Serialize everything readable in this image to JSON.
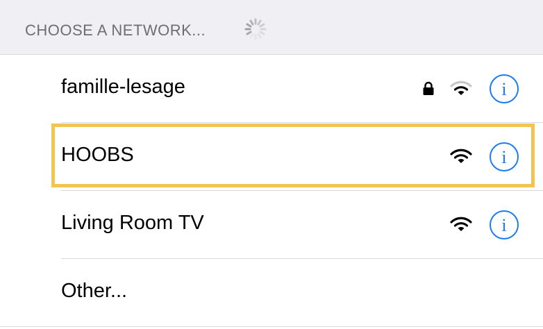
{
  "section": {
    "title": "CHOOSE A NETWORK..."
  },
  "networks": [
    {
      "name": "famille-lesage",
      "locked": true,
      "signal": "wifi-partial",
      "info": "i"
    },
    {
      "name": "HOOBS",
      "locked": false,
      "signal": "wifi-full",
      "info": "i",
      "highlighted": true
    },
    {
      "name": "Living Room TV",
      "locked": false,
      "signal": "wifi-full",
      "info": "i"
    }
  ],
  "other": {
    "label": "Other..."
  },
  "colors": {
    "accent": "#1a7cf2",
    "highlight": "#f2c452",
    "header_bg": "#efeff4",
    "header_text": "#6d6d72"
  },
  "icons": {
    "spinner": "loading-spinner-icon",
    "lock": "lock-icon",
    "wifi": "wifi-signal-icon",
    "info": "info-icon"
  }
}
